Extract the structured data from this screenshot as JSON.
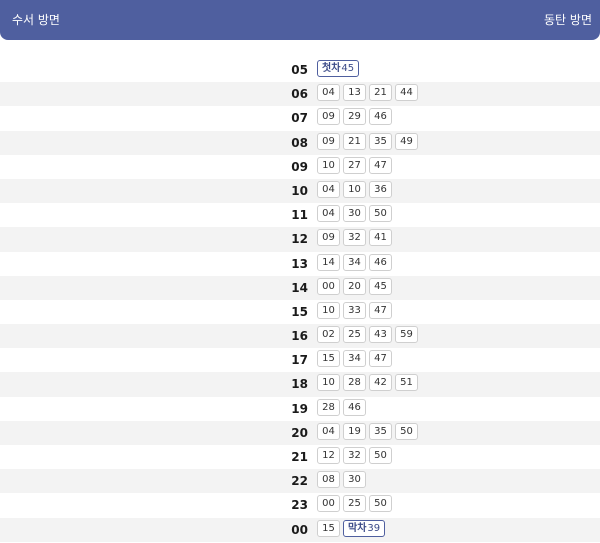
{
  "header": {
    "left_label": "수서 방면",
    "right_label": "동탄 방면"
  },
  "schedule": [
    {
      "hour": "05",
      "minutes": [
        {
          "tag": "첫차",
          "value": "45"
        }
      ]
    },
    {
      "hour": "06",
      "minutes": [
        "04",
        "13",
        "21",
        "44"
      ]
    },
    {
      "hour": "07",
      "minutes": [
        "09",
        "29",
        "46"
      ]
    },
    {
      "hour": "08",
      "minutes": [
        "09",
        "21",
        "35",
        "49"
      ]
    },
    {
      "hour": "09",
      "minutes": [
        "10",
        "27",
        "47"
      ]
    },
    {
      "hour": "10",
      "minutes": [
        "04",
        "10",
        "36"
      ]
    },
    {
      "hour": "11",
      "minutes": [
        "04",
        "30",
        "50"
      ]
    },
    {
      "hour": "12",
      "minutes": [
        "09",
        "32",
        "41"
      ]
    },
    {
      "hour": "13",
      "minutes": [
        "14",
        "34",
        "46"
      ]
    },
    {
      "hour": "14",
      "minutes": [
        "00",
        "20",
        "45"
      ]
    },
    {
      "hour": "15",
      "minutes": [
        "10",
        "33",
        "47"
      ]
    },
    {
      "hour": "16",
      "minutes": [
        "02",
        "25",
        "43",
        "59"
      ]
    },
    {
      "hour": "17",
      "minutes": [
        "15",
        "34",
        "47"
      ]
    },
    {
      "hour": "18",
      "minutes": [
        "10",
        "28",
        "42",
        "51"
      ]
    },
    {
      "hour": "19",
      "minutes": [
        "28",
        "46"
      ]
    },
    {
      "hour": "20",
      "minutes": [
        "04",
        "19",
        "35",
        "50"
      ]
    },
    {
      "hour": "21",
      "minutes": [
        "12",
        "32",
        "50"
      ]
    },
    {
      "hour": "22",
      "minutes": [
        "08",
        "30"
      ]
    },
    {
      "hour": "23",
      "minutes": [
        "00",
        "25",
        "50"
      ]
    },
    {
      "hour": "00",
      "minutes": [
        "15",
        {
          "tag": "막차",
          "value": "39"
        }
      ]
    }
  ]
}
